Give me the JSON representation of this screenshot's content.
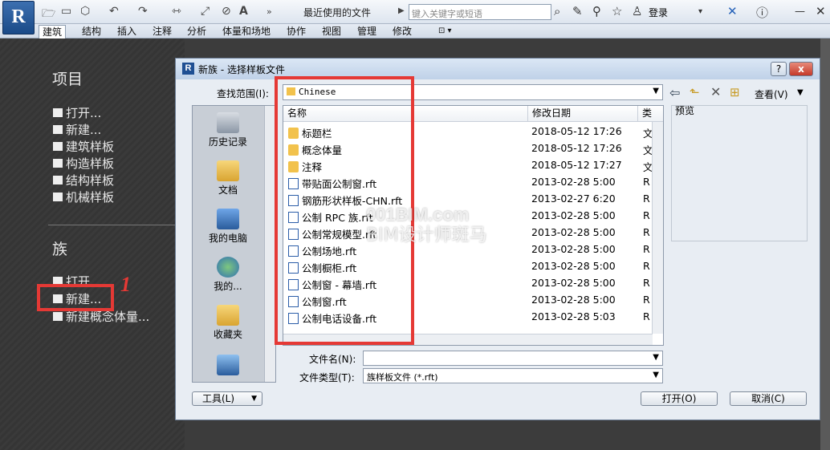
{
  "app": {
    "logo": "R"
  },
  "quick_access": {
    "recent_docs": "最近使用的文件"
  },
  "search": {
    "placeholder": "键入关键字或短语"
  },
  "toolbar": {
    "login": "登录"
  },
  "ribbon_tabs": [
    "建筑",
    "结构",
    "插入",
    "注释",
    "分析",
    "体量和场地",
    "协作",
    "视图",
    "管理",
    "修改"
  ],
  "recent_panel": {
    "projects_title": "项目",
    "projects_links": [
      "打开...",
      "新建...",
      "建筑样板",
      "构造样板",
      "结构样板",
      "机械样板"
    ],
    "families_title": "族",
    "families_links": [
      "打开...",
      "新建...",
      "新建概念体量..."
    ],
    "annotation": "1"
  },
  "dialog": {
    "title": "新族 - 选择样板文件",
    "help_btn": "?",
    "close_btn": "x",
    "look_in_label": "查找范围(I):",
    "look_in_value": "Chinese",
    "view_menu": "查看(V)",
    "preview_label": "预览",
    "places": [
      "历史记录",
      "文档",
      "我的电脑",
      "我的...",
      "收藏夹"
    ],
    "columns": {
      "name": "名称",
      "date": "修改日期",
      "type": "类"
    },
    "files": [
      {
        "name": "标题栏",
        "date": "2018-05-12 17:26",
        "type": "文",
        "kind": "folder"
      },
      {
        "name": "概念体量",
        "date": "2018-05-12 17:26",
        "type": "文",
        "kind": "folder"
      },
      {
        "name": "注释",
        "date": "2018-05-12 17:27",
        "type": "文",
        "kind": "folder"
      },
      {
        "name": "带贴面公制窗.rft",
        "date": "2013-02-28 5:00",
        "type": "R",
        "kind": "file"
      },
      {
        "name": "钢筋形状样板-CHN.rft",
        "date": "2013-02-27 6:20",
        "type": "R",
        "kind": "file"
      },
      {
        "name": "公制 RPC 族.rft",
        "date": "2013-02-28 5:00",
        "type": "R",
        "kind": "file"
      },
      {
        "name": "公制常规模型.rft",
        "date": "2013-02-28 5:00",
        "type": "R",
        "kind": "file"
      },
      {
        "name": "公制场地.rft",
        "date": "2013-02-28 5:00",
        "type": "R",
        "kind": "file"
      },
      {
        "name": "公制橱柜.rft",
        "date": "2013-02-28 5:00",
        "type": "R",
        "kind": "file"
      },
      {
        "name": "公制窗 - 幕墙.rft",
        "date": "2013-02-28 5:00",
        "type": "R",
        "kind": "file"
      },
      {
        "name": "公制窗.rft",
        "date": "2013-02-28 5:00",
        "type": "R",
        "kind": "file"
      },
      {
        "name": "公制电话设备.rft",
        "date": "2013-02-28 5:03",
        "type": "R",
        "kind": "file"
      }
    ],
    "filename_label": "文件名(N):",
    "filename_value": "",
    "filetype_label": "文件类型(T):",
    "filetype_value": "族样板文件 (*.rft)",
    "tools_btn": "工具(L)",
    "open_btn": "打开(O)",
    "cancel_btn": "取消(C)"
  },
  "watermark": {
    "line1": "001BIM.com",
    "line2": "BIM设计师斑马"
  },
  "colors": {
    "highlight": "#e53935",
    "panel_bg": "#3a3a3a"
  }
}
